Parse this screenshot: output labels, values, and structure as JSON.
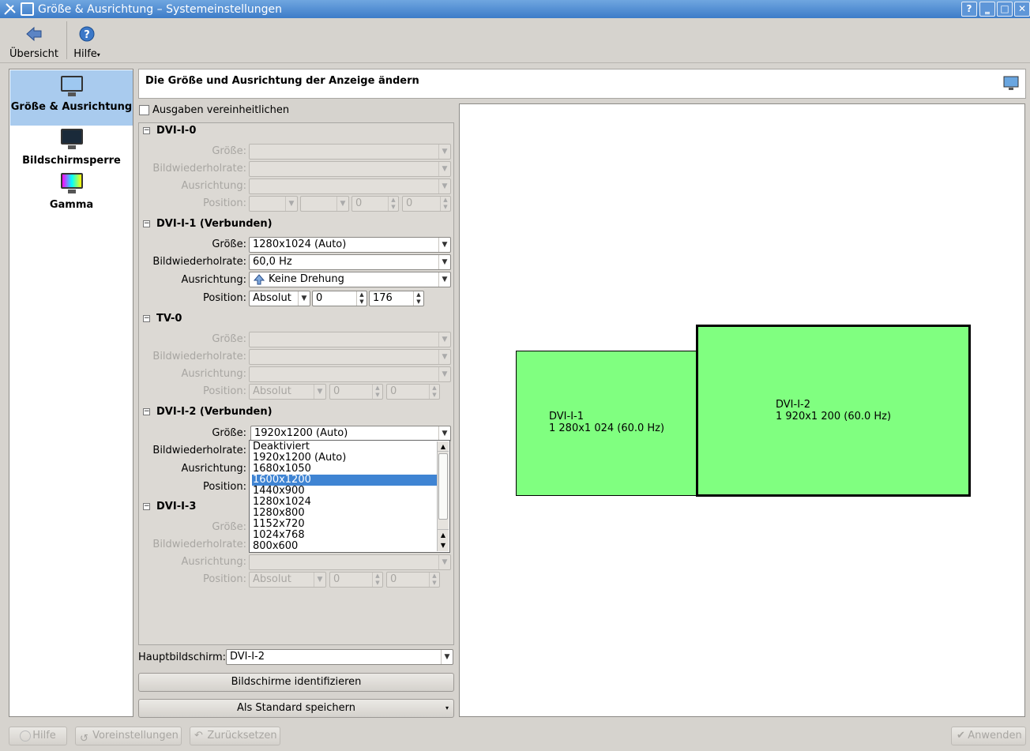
{
  "window": {
    "title": "Größe & Ausrichtung – Systemeinstellungen",
    "help_btn": "?",
    "min_btn": "‗",
    "max_btn": "□",
    "close_btn": "✕"
  },
  "toolbar": {
    "overview": "Übersicht",
    "help": "Hilfe"
  },
  "sidebar": {
    "items": [
      {
        "label": "Größe & Ausrichtung",
        "icon": "monitor-icon"
      },
      {
        "label": "Bildschirmsperre",
        "icon": "screensaver-icon"
      },
      {
        "label": "Gamma",
        "icon": "gamma-icon"
      }
    ]
  },
  "header": {
    "title": "Die Größe und Ausrichtung der Anzeige ändern"
  },
  "unify": {
    "label": "Ausgaben vereinheitlichen",
    "checked": false
  },
  "labels": {
    "size": "Größe:",
    "refresh": "Bildwiederholrate:",
    "orientation": "Ausrichtung:",
    "position": "Position:"
  },
  "outputs": [
    {
      "name": "DVI-I-0",
      "size": "",
      "refresh": "",
      "orientation": "",
      "pos_mode": "",
      "x": "0",
      "y": "0"
    },
    {
      "name": "DVI-I-1 (Verbunden)",
      "size": "1280x1024 (Auto)",
      "refresh": "60,0 Hz",
      "orientation": "Keine Drehung",
      "pos_mode": "Absolut",
      "x": "0",
      "y": "176"
    },
    {
      "name": "TV-0",
      "size": "",
      "refresh": "",
      "orientation": "",
      "pos_mode": "Absolut",
      "x": "0",
      "y": "0"
    },
    {
      "name": "DVI-I-2 (Verbunden)",
      "size": "1920x1200 (Auto)"
    },
    {
      "name": "DVI-I-3",
      "size": "",
      "refresh": "",
      "orientation": "",
      "pos_mode": "Absolut",
      "x": "0",
      "y": "0"
    }
  ],
  "size_dropdown": {
    "options": [
      "Deaktiviert",
      "1920x1200 (Auto)",
      "1680x1050",
      "1600x1200",
      "1440x900",
      "1280x1024",
      "1280x800",
      "1152x720",
      "1024x768",
      "800x600"
    ],
    "highlighted": "1600x1200"
  },
  "primary": {
    "label": "Hauptbildschirm:",
    "value": "DVI-I-2"
  },
  "buttons": {
    "identify": "Bildschirme identifizieren",
    "save_default": "Als Standard speichern",
    "help": "Hilfe",
    "defaults": "Voreinstellungen",
    "reset": "Zurücksetzen",
    "apply": "Anwenden"
  },
  "layout": {
    "screens": [
      {
        "name": "DVI-I-1",
        "mode": "1 280x1 024 (60.0 Hz)",
        "color": "#80ff80"
      },
      {
        "name": "DVI-I-2",
        "mode": "1 920x1 200 (60.0 Hz)",
        "color": "#80ff80"
      }
    ]
  }
}
